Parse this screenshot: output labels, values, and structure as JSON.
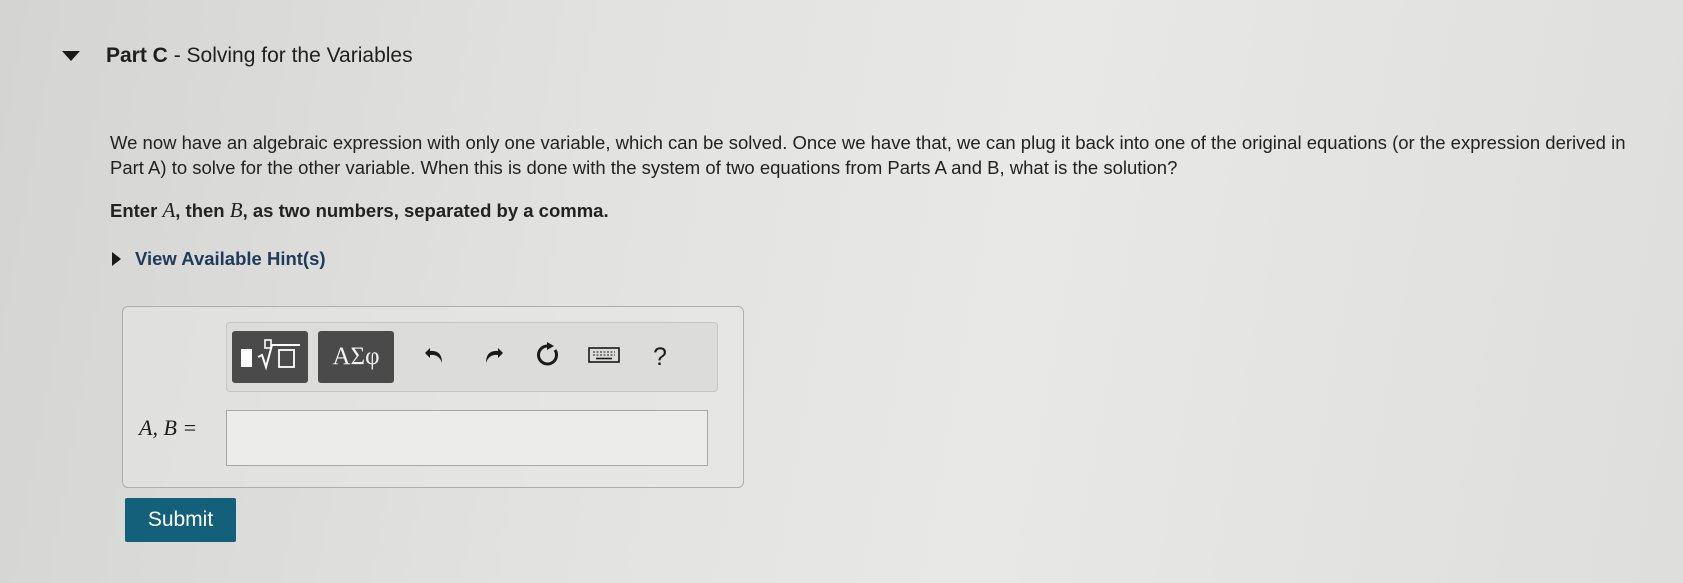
{
  "part": {
    "prefix": "Part C",
    "separator": " - ",
    "title": "Solving for the Variables"
  },
  "body_text": "We now have an algebraic expression with only one variable, which can be solved. Once we have that, we can plug it back into one of the original equations (or the expression derived in Part A) to solve for the other variable. When this is done with the system of two equations from Parts A and B, what is the solution?",
  "instruction": {
    "t1": "Enter ",
    "var_a": "A",
    "t2": ", then ",
    "var_b": "B",
    "t3": ", as two numbers, separated by a comma."
  },
  "hint_label": "View Available Hint(s)",
  "toolbar": {
    "greek_label": "ΑΣφ",
    "help_label": "?",
    "icons": [
      "templates-icon",
      "undo-icon",
      "redo-icon",
      "reset-icon",
      "keyboard-icon",
      "help-icon"
    ]
  },
  "answer": {
    "label": "A, B =",
    "value": ""
  },
  "submit_label": "Submit"
}
